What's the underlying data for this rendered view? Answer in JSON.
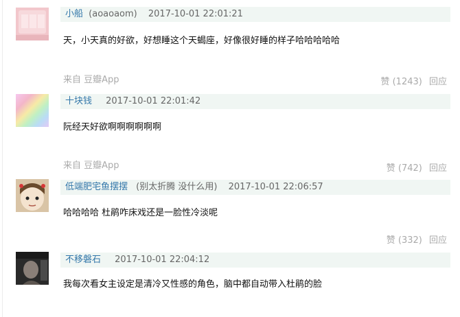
{
  "comments": [
    {
      "author": "小船",
      "nickname": "(aoaoaom)",
      "time": "2017-10-01 22:01:21",
      "content": "天，小天真的好欲，好想睡这个天蝎座，好像很好睡的样子哈哈哈哈哈",
      "source_prefix": "来自",
      "source_app": "豆瓣App",
      "like_label": "赞",
      "like_count": "(1243)",
      "reply_label": "回应"
    },
    {
      "author": "十块钱",
      "nickname": "",
      "time": "2017-10-01 22:01:42",
      "content": "阮经天好欲啊啊啊啊啊啊",
      "source_prefix": "来自",
      "source_app": "豆瓣App",
      "like_label": "赞",
      "like_count": "(742)",
      "reply_label": "回应"
    },
    {
      "author": "低端肥宅鱼摆摆",
      "nickname": "(别太折腾 没什么用)",
      "time": "2017-10-01 22:06:57",
      "content": "哈哈哈哈 杜鹃咋床戏还是一脸性冷淡呢",
      "source_prefix": "",
      "source_app": "",
      "like_label": "赞",
      "like_count": "(332)",
      "reply_label": "回应"
    },
    {
      "author": "不移磐石",
      "nickname": "",
      "time": "2017-10-01 22:04:12",
      "content": "我每次看女主设定是清冷又性感的角色，脑中都自动带入杜鹃的脸"
    }
  ]
}
